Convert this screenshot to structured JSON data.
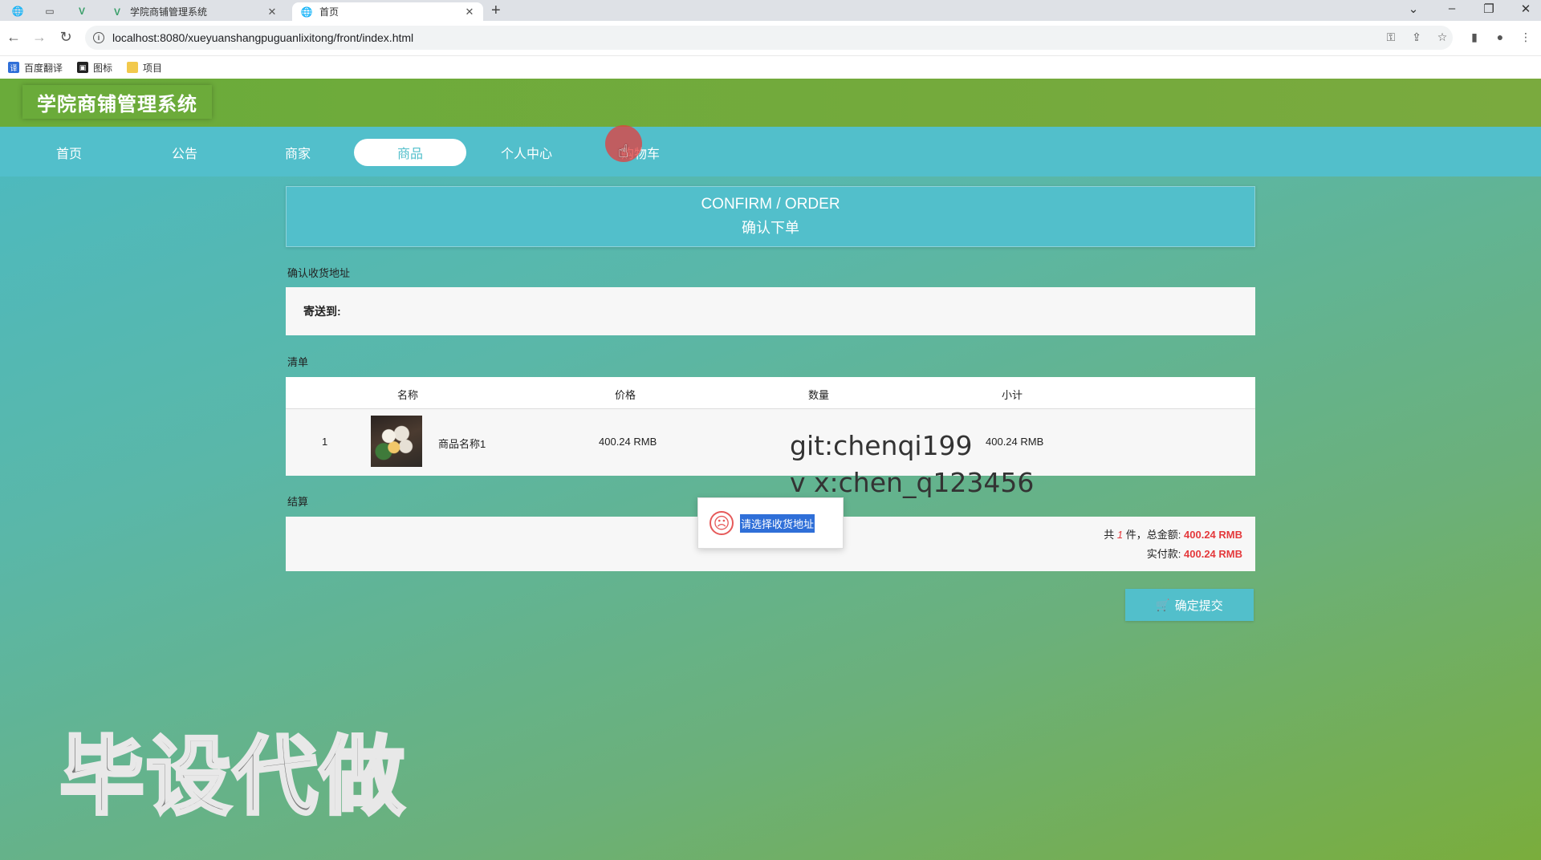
{
  "browser": {
    "tabs": [
      {
        "icon": "vue-logo-icon",
        "title": "学院商铺管理系统",
        "active": false
      },
      {
        "icon": "globe-icon",
        "title": "首页",
        "active": true
      }
    ],
    "url": "localhost:8080/xueyuanshangpuguanlixitong/front/index.html",
    "bookmarks": [
      {
        "label": "百度翻译",
        "icon": "translate-icon",
        "color": "#2f6fd8"
      },
      {
        "label": "图标",
        "icon": "image-icon",
        "color": "#222222"
      },
      {
        "label": "项目",
        "icon": "folder-icon",
        "color": "#f2c94c"
      }
    ]
  },
  "site": {
    "title": "学院商铺管理系统",
    "nav": [
      {
        "label": "首页",
        "active": false
      },
      {
        "label": "公告",
        "active": false
      },
      {
        "label": "商家",
        "active": false
      },
      {
        "label": "商品",
        "active": true
      },
      {
        "label": "个人中心",
        "active": false
      },
      {
        "label": "购物车",
        "active": false
      }
    ]
  },
  "order": {
    "banner_en": "CONFIRM / ORDER",
    "banner_zh": "确认下单",
    "address_section": "确认收货地址",
    "ship_to_label": "寄送到:",
    "list_section": "清单",
    "columns": [
      "名称",
      "价格",
      "数量",
      "小计"
    ],
    "items": [
      {
        "index": "1",
        "name": "商品名称1",
        "price": "400.24 RMB",
        "subtotal": "400.24 RMB"
      }
    ],
    "settle_section": "结算",
    "summary": {
      "count_prefix": "共",
      "count": "1",
      "count_suffix": "件，总金额:",
      "total": "400.24 RMB",
      "paid_label": "实付款:",
      "paid": "400.24 RMB"
    },
    "submit_label": "确定提交"
  },
  "toast": {
    "message": "请选择收货地址",
    "icon": "sad-face-icon"
  },
  "overlay": {
    "line1": "git:chenqi199",
    "line2": "v x:chen_q123456",
    "watermark": "毕设代做"
  },
  "colors": {
    "accent": "#52bfcb",
    "header_green": "#6aab3a",
    "price_red": "#e4393c"
  }
}
